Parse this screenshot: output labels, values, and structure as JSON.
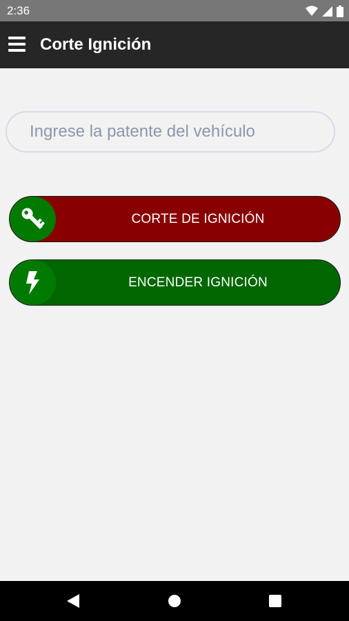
{
  "status_bar": {
    "time": "2:36",
    "icons": [
      "wifi-icon",
      "cell-signal-icon",
      "battery-icon"
    ]
  },
  "app_bar": {
    "title": "Corte Ignición",
    "menu_icon": "hamburger-menu-icon"
  },
  "search": {
    "placeholder": "Ingrese la patente del vehículo",
    "value": ""
  },
  "buttons": {
    "cut": {
      "label": "CORTE DE IGNICIÓN",
      "icon": "key-icon",
      "color": "#880000"
    },
    "on": {
      "label": "ENCENDER IGNICIÓN",
      "icon": "lightning-bolt-icon",
      "color": "#006600"
    }
  },
  "nav_bar": {
    "buttons": [
      "back-icon",
      "home-icon",
      "recents-icon"
    ]
  },
  "colors": {
    "status_bar": "#777777",
    "app_bar": "#262626",
    "background": "#f2f2f2",
    "icon_circle": "#007a00"
  }
}
